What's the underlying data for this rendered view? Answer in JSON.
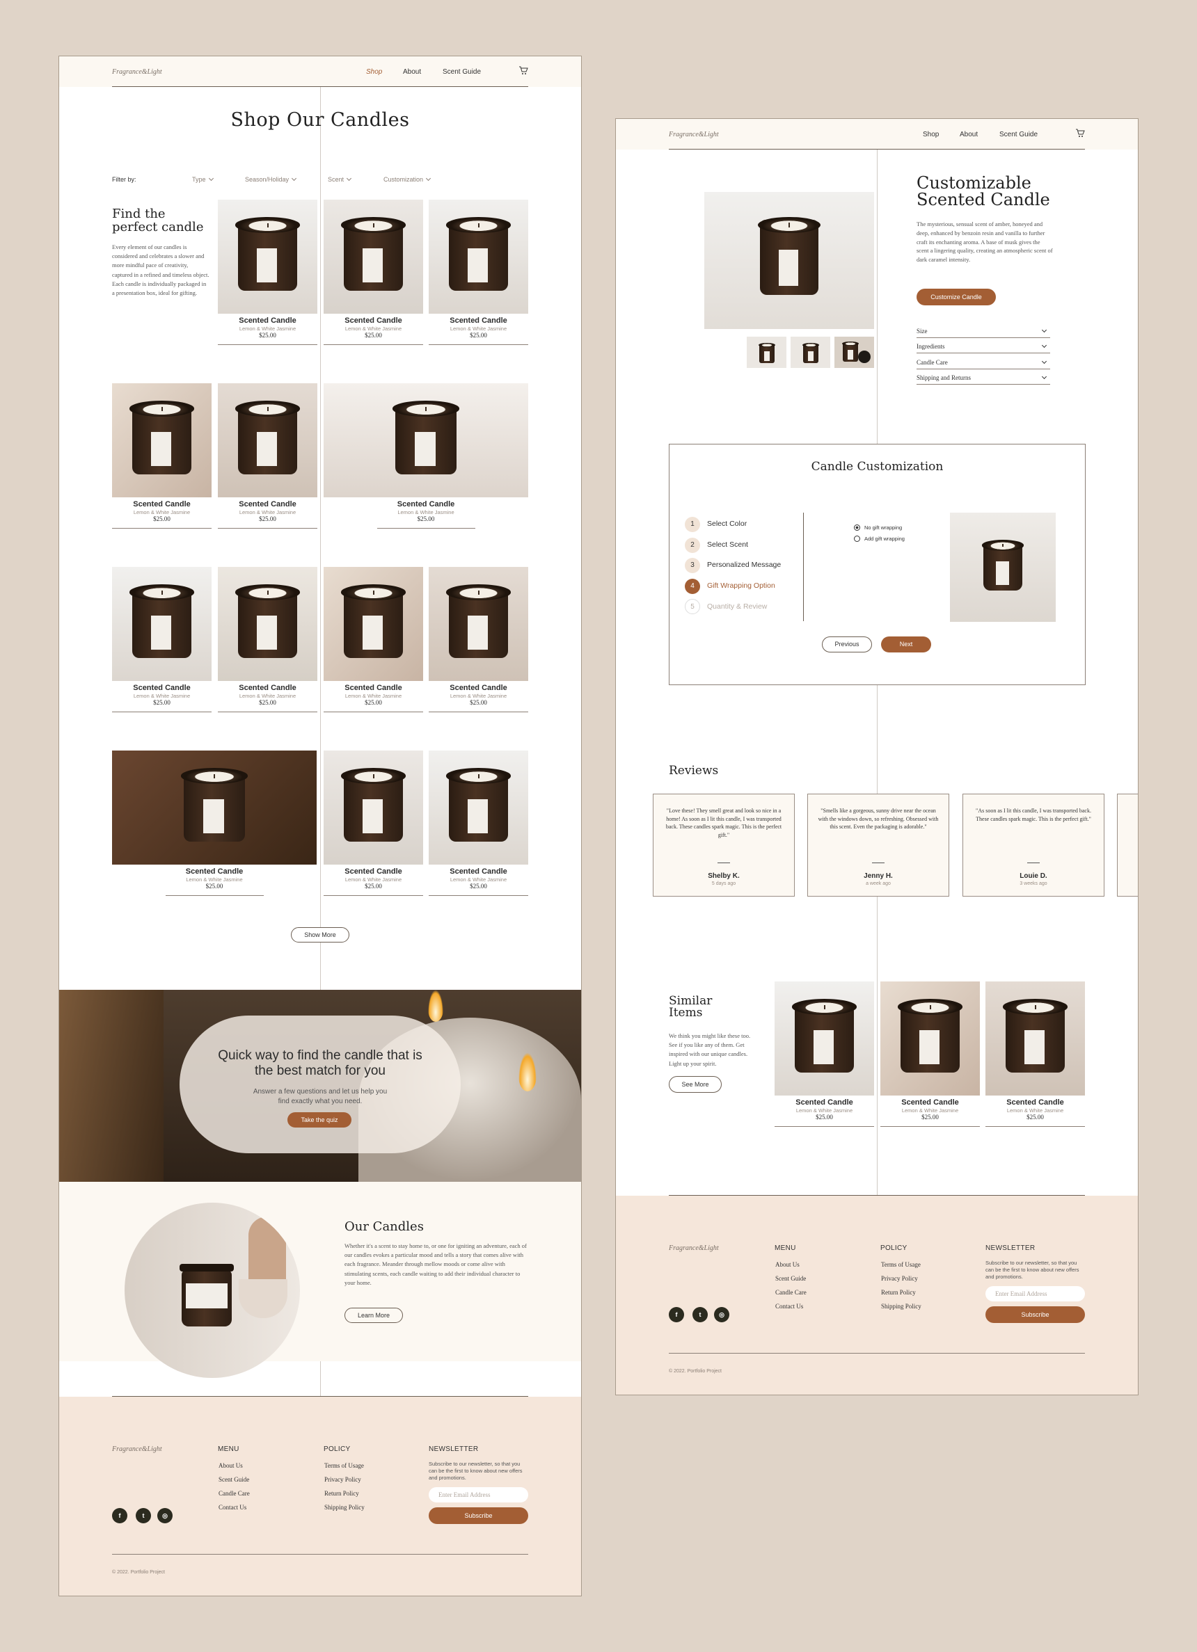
{
  "left": {
    "header": {
      "logo": "Fragrance&Light",
      "nav": [
        "Shop",
        "About",
        "Scent Guide"
      ]
    },
    "title": "Shop Our Candles",
    "filter": {
      "label": "Filter by:",
      "options": [
        "Type",
        "Season/Holiday",
        "Scent",
        "Customization"
      ]
    },
    "intro": {
      "heading": "Find the perfect candle",
      "body": "Every element of our candles is considered and celebrates a slower and more mindful pace of creativity, captured in a refined and timeless object. Each candle is individually packaged in a presentation box, ideal for gifting."
    },
    "product": {
      "name": "Scented Candle",
      "sub": "Lemon & White Jasmine",
      "price": "$25.00"
    },
    "show_more": "Show More",
    "quiz": {
      "title": "Quick way to find the candle that is the best match for you",
      "body": "Answer a few questions and let us help you find exactly what you need.",
      "button": "Take the quiz"
    },
    "about": {
      "heading": "Our Candles",
      "body": "Whether it's a scent to stay home to, or one for igniting an adventure, each of our candles evokes a particular mood and tells a story that comes alive with each fragrance. Meander through mellow moods or come alive with stimulating scents, each candle waiting to add their individual character to your home.",
      "button": "Learn More"
    },
    "footer": {
      "logo": "Fragrance&Light",
      "menu_head": "MENU",
      "menu": [
        "About Us",
        "Scent Guide",
        "Candle Care",
        "Contact Us"
      ],
      "policy_head": "POLICY",
      "policy": [
        "Terms of Usage",
        "Privacy Policy",
        "Return Policy",
        "Shipping Policy"
      ],
      "news_head": "NEWSLETTER",
      "news_text": "Subscribe to our newsletter, so that you can be the first to know about new offers and promotions.",
      "email_placeholder": "Enter Email Address",
      "subscribe": "Subscribe",
      "copyright": "© 2022. Portfolio Project"
    }
  },
  "right": {
    "header": {
      "logo": "Fragrance&Light",
      "nav": [
        "Shop",
        "About",
        "Scent Guide"
      ]
    },
    "product_title": "Customizable Scented Candle",
    "product_desc": "The mysterious, sensual scent of amber, honeyed and deep, enhanced by benzoin resin and vanilla to further craft its enchanting aroma. A base of musk gives the scent a lingering quality, creating an atmospheric scent of dark caramel intensity.",
    "customize_button": "Customize Candle",
    "accordion": [
      "Size",
      "Ingredients",
      "Candle Care",
      "Shipping and Returns"
    ],
    "customization": {
      "title": "Candle Customization",
      "steps": [
        {
          "n": "1",
          "label": "Select Color"
        },
        {
          "n": "2",
          "label": "Select Scent"
        },
        {
          "n": "3",
          "label": "Personalized Message"
        },
        {
          "n": "4",
          "label": "Gift Wrapping Option"
        },
        {
          "n": "5",
          "label": "Quantity & Review"
        }
      ],
      "options": [
        "No gift wrapping",
        "Add gift wrapping"
      ],
      "prev": "Previous",
      "next": "Next"
    },
    "reviews_title": "Reviews",
    "reviews": [
      {
        "quote": "\"Love these! They smell great and look so nice in a home! As soon as I lit this candle, I was transported back. These candles spark magic. This is the perfect gift.\"",
        "name": "Shelby K.",
        "time": "5 days ago"
      },
      {
        "quote": "\"Smells like a gorgeous, sunny drive near the ocean with the windows down, so refreshing. Obsessed with this scent. Even the packaging is adorable.\"",
        "name": "Jenny H.",
        "time": "a week ago"
      },
      {
        "quote": "\"As soon as I lit this candle, I was transported back. These candles spark magic. This is the perfect gift.\"",
        "name": "Louie D.",
        "time": "3 weeks ago"
      }
    ],
    "similar": {
      "heading": "Similar Items",
      "body": "We think you might like these too. See if you like any of them. Get inspired with our unique candles. Light up your spirit.",
      "button": "See More"
    },
    "product": {
      "name": "Scented Candle",
      "sub": "Lemon & White Jasmine",
      "price": "$25.00"
    },
    "footer": {
      "logo": "Fragrance&Light",
      "menu_head": "MENU",
      "menu": [
        "About Us",
        "Scent Guide",
        "Candle Care",
        "Contact Us"
      ],
      "policy_head": "POLICY",
      "policy": [
        "Terms of Usage",
        "Privacy Policy",
        "Return Policy",
        "Shipping Policy"
      ],
      "news_head": "NEWSLETTER",
      "news_text": "Subscribe to our newsletter, so that you can be the first to know about new offers and promotions.",
      "email_placeholder": "Enter Email Address",
      "subscribe": "Subscribe",
      "copyright": "© 2022. Portfolio Project"
    }
  },
  "colors": {
    "accent": "#a35e34",
    "cream": "#fcf8f2",
    "footer": "#f5e6da",
    "dark": "#2b2b1f"
  }
}
